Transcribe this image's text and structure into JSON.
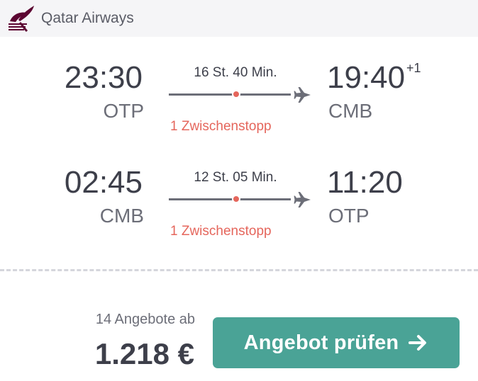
{
  "airline": {
    "name": "Qatar Airways",
    "logo_icon": "oryx-logo-icon",
    "logo_color": "#5c0632"
  },
  "segments": [
    {
      "departure_time": "23:30",
      "departure_code": "OTP",
      "duration": "16 St. 40 Min.",
      "stops": "1 Zwischenstopp",
      "arrival_time": "19:40",
      "arrival_day_offset": "+1",
      "arrival_code": "CMB"
    },
    {
      "departure_time": "02:45",
      "departure_code": "CMB",
      "duration": "12 St. 05 Min.",
      "stops": "1 Zwischenstopp",
      "arrival_time": "11:20",
      "arrival_code": "OTP"
    }
  ],
  "offer": {
    "count_label": "14 Angebote ab",
    "price": "1.218 €",
    "button_label": "Angebot prüfen",
    "button_icon": "arrow-right-icon",
    "button_color": "#4aa396"
  },
  "colors": {
    "stop_dot": "#e5665c",
    "stops_text": "#e5665c",
    "text_primary": "#3d3f4a",
    "text_secondary": "#6c6e78"
  }
}
